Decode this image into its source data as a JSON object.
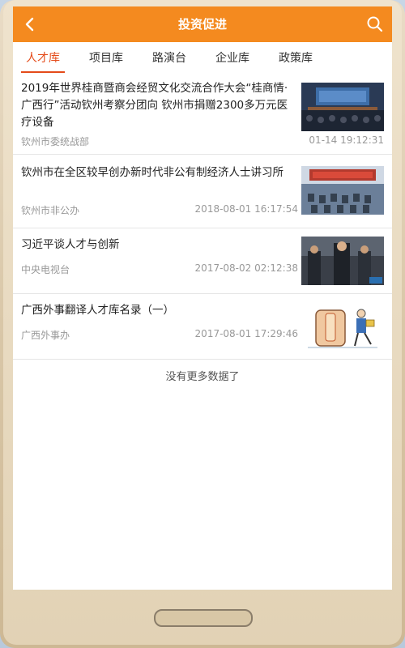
{
  "header": {
    "title": "投资促进",
    "back_icon": "chevron-left-icon",
    "search_icon": "search-icon"
  },
  "colors": {
    "accent": "#f48a1f",
    "tab_active": "#e44b1a"
  },
  "tabs": [
    {
      "label": "人才库",
      "active": true
    },
    {
      "label": "项目库",
      "active": false
    },
    {
      "label": "路演台",
      "active": false
    },
    {
      "label": "企业库",
      "active": false
    },
    {
      "label": "政策库",
      "active": false
    }
  ],
  "news": [
    {
      "title": "2019年世界桂商暨商会经贸文化交流合作大会“桂商情·广西行”活动钦州考察分团向 钦州市捐赠2300多万元医疗设备",
      "source": "钦州市委统战部",
      "time": "01-14 19:12:31"
    },
    {
      "title": "钦州市在全区较早创办新时代非公有制经济人士讲习所",
      "source": "钦州市非公办",
      "time": "2018-08-01 16:17:54"
    },
    {
      "title": "习近平谈人才与创新",
      "source": "中央电视台",
      "time": "2017-08-02 02:12:38"
    },
    {
      "title": "广西外事翻译人才库名录（一）",
      "source": "广西外事办",
      "time": "2017-08-01 17:29:46"
    }
  ],
  "footer": {
    "no_more": "没有更多数据了"
  }
}
